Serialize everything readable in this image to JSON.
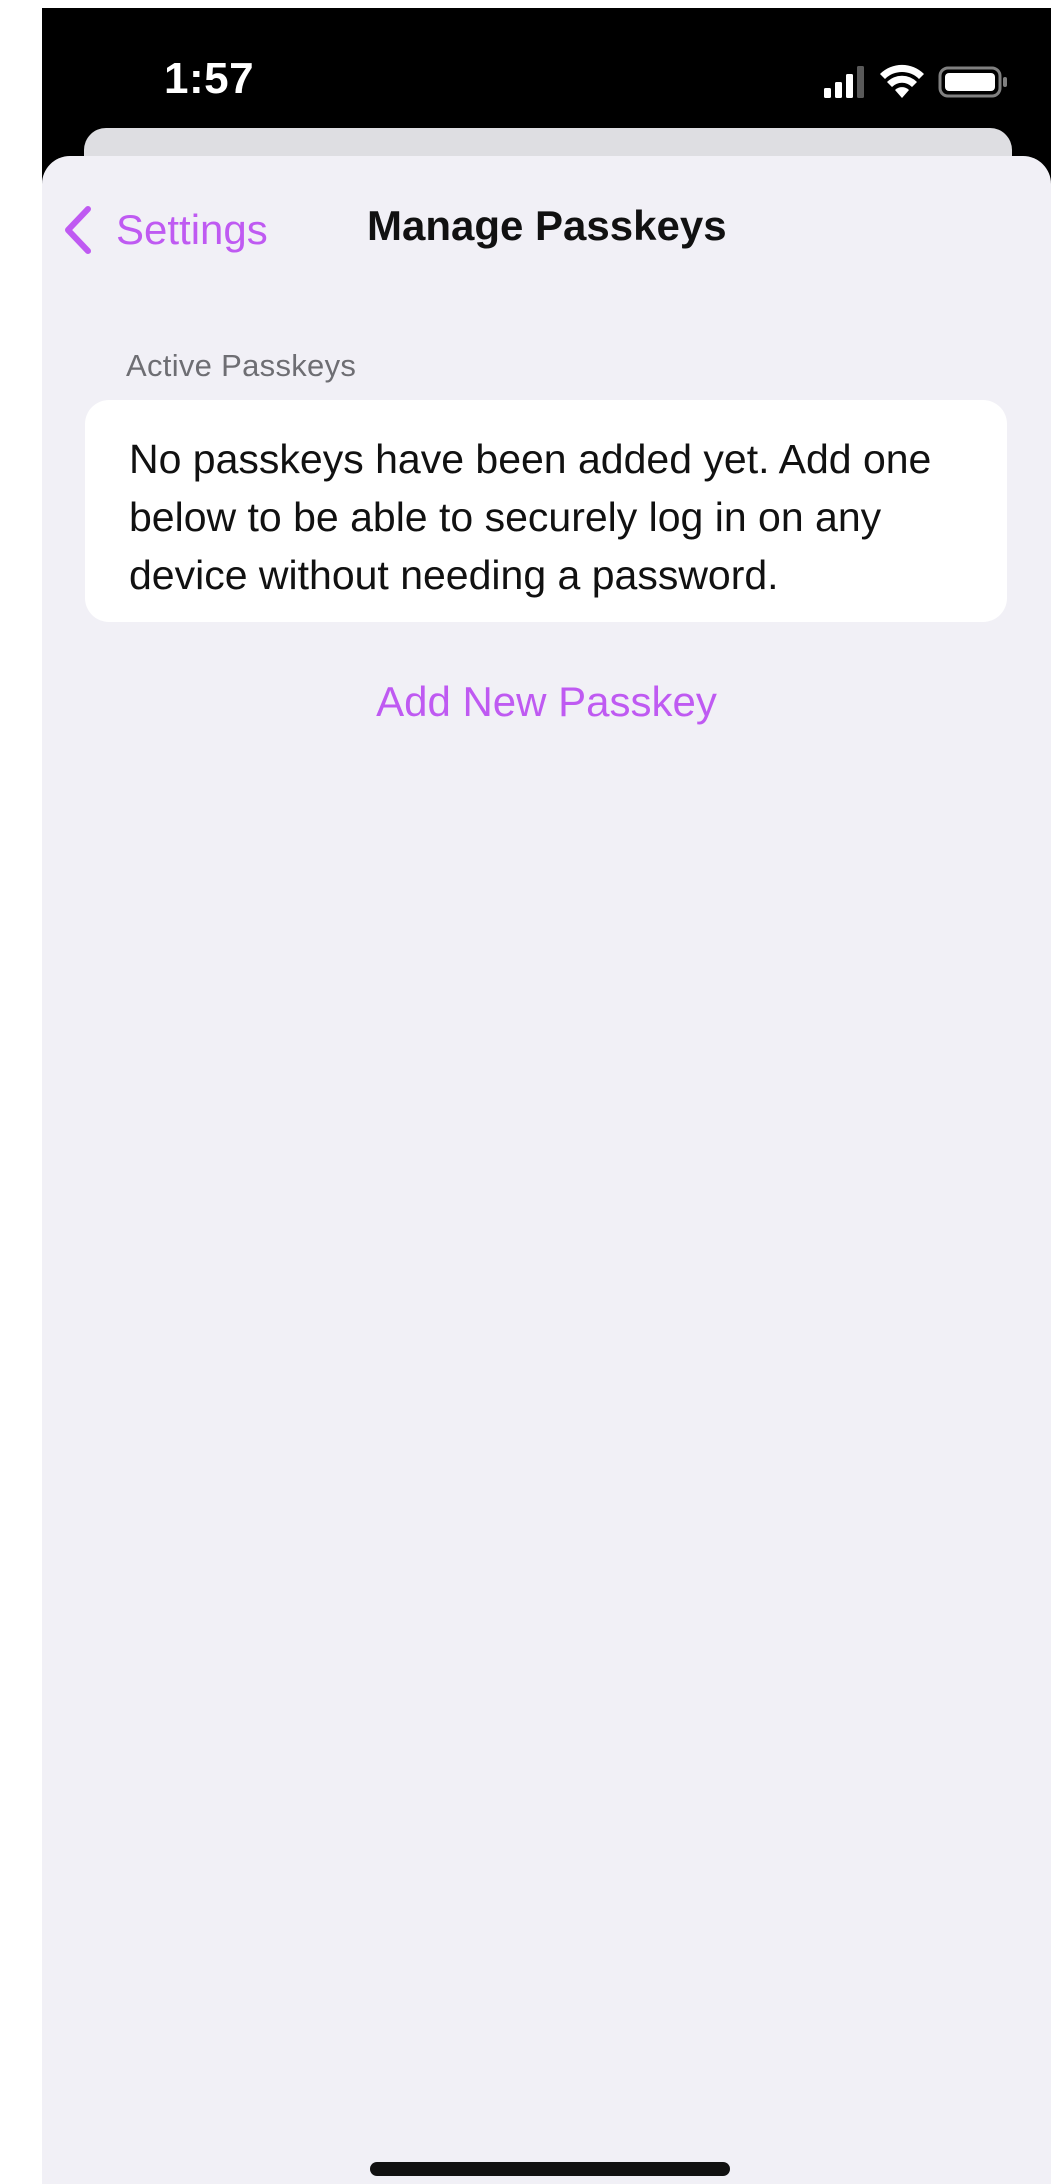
{
  "status_bar": {
    "time": "1:57",
    "icons": [
      "signal-icon",
      "wifi-icon",
      "battery-icon"
    ]
  },
  "nav": {
    "back_label": "Settings",
    "title": "Manage Passkeys"
  },
  "section": {
    "header": "Active Passkeys",
    "empty_message": "No passkeys have been added yet. Add one below to be able to securely log in on any device without needing a password."
  },
  "actions": {
    "add_label": "Add New Passkey"
  },
  "colors": {
    "accent": "#bf5af2",
    "background": "#f1f0f6",
    "card": "#ffffff",
    "text": "#111111",
    "secondary_text": "#6e6e73"
  }
}
